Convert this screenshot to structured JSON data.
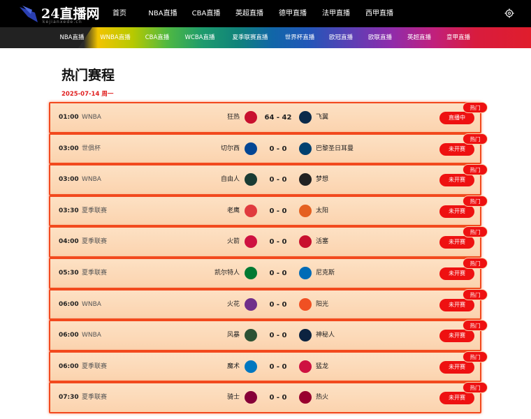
{
  "header": {
    "logo_text": "24直播网",
    "logo_sub": "kejianxede.cn",
    "nav": [
      "首页",
      "NBA直播",
      "CBA直播",
      "英超直播",
      "德甲直播",
      "法甲直播",
      "西甲直播"
    ]
  },
  "subnav": [
    "NBA直播",
    "WNBA直播",
    "CBA直播",
    "WCBA直播",
    "夏季联赛直播",
    "世界杯直播",
    "欧冠直播",
    "欧联直播",
    "英超直播",
    "意甲直播"
  ],
  "page_title": "热门赛程",
  "date": "2025-07-14 周一",
  "matches": [
    {
      "time": "01:00",
      "league": "WNBA",
      "home": "狂热",
      "score": "64 - 42",
      "away": "飞翼",
      "status": "直播中",
      "hot": "热门",
      "home_color": "#c8102e",
      "away_color": "#0b2a4a"
    },
    {
      "time": "03:00",
      "league": "世俱杯",
      "home": "切尔西",
      "score": "0 - 0",
      "away": "巴黎圣日耳曼",
      "status": "未开赛",
      "hot": "热门",
      "home_color": "#034694",
      "away_color": "#004170"
    },
    {
      "time": "03:00",
      "league": "WNBA",
      "home": "自由人",
      "score": "0 - 0",
      "away": "梦想",
      "status": "未开赛",
      "hot": "热门",
      "home_color": "#1a3c34",
      "away_color": "#222222"
    },
    {
      "time": "03:30",
      "league": "夏季联赛",
      "home": "老鹰",
      "score": "0 - 0",
      "away": "太阳",
      "status": "未开赛",
      "hot": "热门",
      "home_color": "#e03a3e",
      "away_color": "#e56020"
    },
    {
      "time": "04:00",
      "league": "夏季联赛",
      "home": "火箭",
      "score": "0 - 0",
      "away": "活塞",
      "status": "未开赛",
      "hot": "热门",
      "home_color": "#ce1141",
      "away_color": "#c8102e"
    },
    {
      "time": "05:30",
      "league": "夏季联赛",
      "home": "凯尔特人",
      "score": "0 - 0",
      "away": "尼克斯",
      "status": "未开赛",
      "hot": "热门",
      "home_color": "#007a33",
      "away_color": "#006bb6"
    },
    {
      "time": "06:00",
      "league": "WNBA",
      "home": "火花",
      "score": "0 - 0",
      "away": "阳光",
      "status": "未开赛",
      "hot": "热门",
      "home_color": "#702f8a",
      "away_color": "#f05023"
    },
    {
      "time": "06:00",
      "league": "WNBA",
      "home": "风暴",
      "score": "0 - 0",
      "away": "神秘人",
      "status": "未开赛",
      "hot": "热门",
      "home_color": "#2c5234",
      "away_color": "#0c2340"
    },
    {
      "time": "06:00",
      "league": "夏季联赛",
      "home": "魔术",
      "score": "0 - 0",
      "away": "猛龙",
      "status": "未开赛",
      "hot": "热门",
      "home_color": "#0077c0",
      "away_color": "#ce1141"
    },
    {
      "time": "07:30",
      "league": "夏季联赛",
      "home": "骑士",
      "score": "0 - 0",
      "away": "热火",
      "status": "未开赛",
      "hot": "热门",
      "home_color": "#860038",
      "away_color": "#98002e"
    }
  ]
}
